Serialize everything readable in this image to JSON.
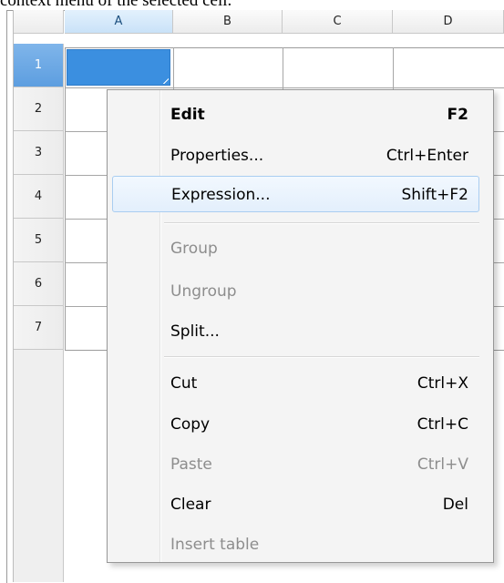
{
  "caption": "context menu of the selected cell.",
  "columns": [
    "A",
    "B",
    "C",
    "D"
  ],
  "rows": [
    "1",
    "2",
    "3",
    "4",
    "5",
    "6",
    "7"
  ],
  "menu": {
    "items": [
      {
        "label": "Edit",
        "shortcut": "F2",
        "bold": true,
        "disabled": false
      },
      {
        "label": "Properties...",
        "shortcut": "Ctrl+Enter",
        "disabled": false
      },
      {
        "label": "Expression...",
        "shortcut": "Shift+F2",
        "disabled": false,
        "highlighted": true
      },
      {
        "label": "Group",
        "shortcut": "",
        "disabled": true
      },
      {
        "label": "Ungroup",
        "shortcut": "",
        "disabled": true
      },
      {
        "label": "Split...",
        "shortcut": "",
        "disabled": false
      },
      {
        "label": "Cut",
        "shortcut": "Ctrl+X",
        "disabled": false
      },
      {
        "label": "Copy",
        "shortcut": "Ctrl+C",
        "disabled": false
      },
      {
        "label": "Paste",
        "shortcut": "Ctrl+V",
        "disabled": true
      },
      {
        "label": "Clear",
        "shortcut": "Del",
        "disabled": false
      },
      {
        "label": "Insert table",
        "shortcut": "",
        "disabled": true
      }
    ]
  },
  "colors": {
    "selection": "#3b8fe0",
    "menu_highlight_border": "#a9cdf1",
    "disabled_text": "#8d8d8d"
  }
}
